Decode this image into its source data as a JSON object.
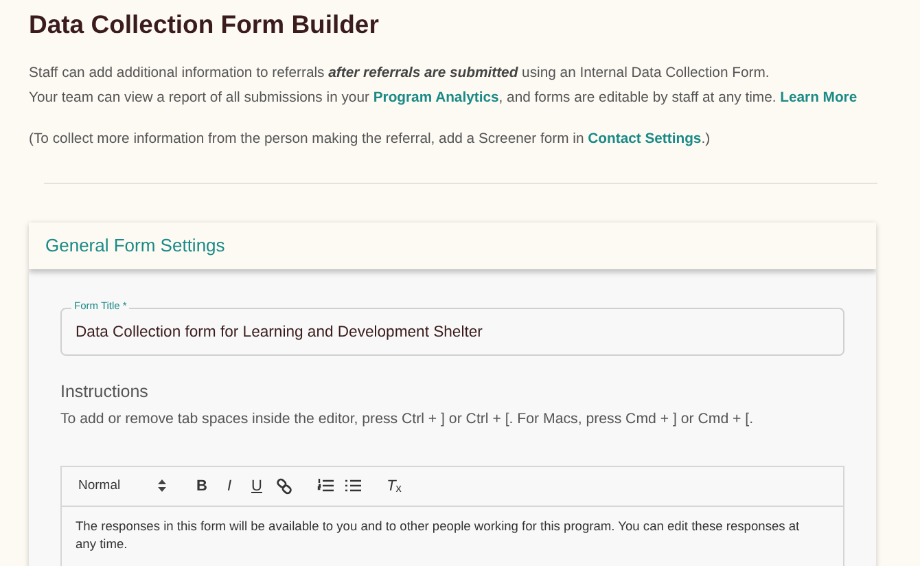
{
  "page_title": "Data Collection Form Builder",
  "intro": [
    {
      "segments": [
        {
          "kind": "text",
          "text": "Staff can add additional information to referrals **after referrals are submitted** using an Internal Data Collection Form."
        }
      ]
    },
    {
      "segments": [
        {
          "kind": "text",
          "text": "Your team can view a report of all submissions in your "
        },
        {
          "kind": "link",
          "text": "Program Analytics"
        },
        {
          "kind": "text",
          "text": ", and forms are editable by staff at any time. "
        },
        {
          "kind": "link",
          "text": "Learn More"
        }
      ]
    }
  ],
  "note": {
    "segments": [
      {
        "kind": "text",
        "text": "(To collect more information from the person making the referral, add a Screener form in "
      },
      {
        "kind": "link",
        "text": "Contact Settings"
      },
      {
        "kind": "text",
        "text": ".)"
      }
    ]
  },
  "card": {
    "title": "General Form Settings",
    "form_title": {
      "label": "Form Title *",
      "value": "Data Collection form for Learning and Development Shelter"
    },
    "instructions": {
      "heading": "Instructions",
      "hint": "To add or remove tab spaces inside the editor, press Ctrl + ] or Ctrl + [. For Macs, press Cmd + ] or Cmd + [."
    },
    "editor": {
      "format": "Normal",
      "toolbar": [
        {
          "kind": "bold",
          "label": "B"
        },
        {
          "kind": "italic",
          "label": "I"
        },
        {
          "kind": "underline",
          "label": "U"
        },
        {
          "kind": "link"
        },
        {
          "kind": "gap"
        },
        {
          "kind": "ordered-list"
        },
        {
          "kind": "bullet-list"
        },
        {
          "kind": "gap"
        },
        {
          "kind": "clear",
          "label": "*T*$_{x}$"
        }
      ],
      "content": "The responses in this form will be available to you and to other people working for this program. You can edit these responses at any time."
    }
  }
}
